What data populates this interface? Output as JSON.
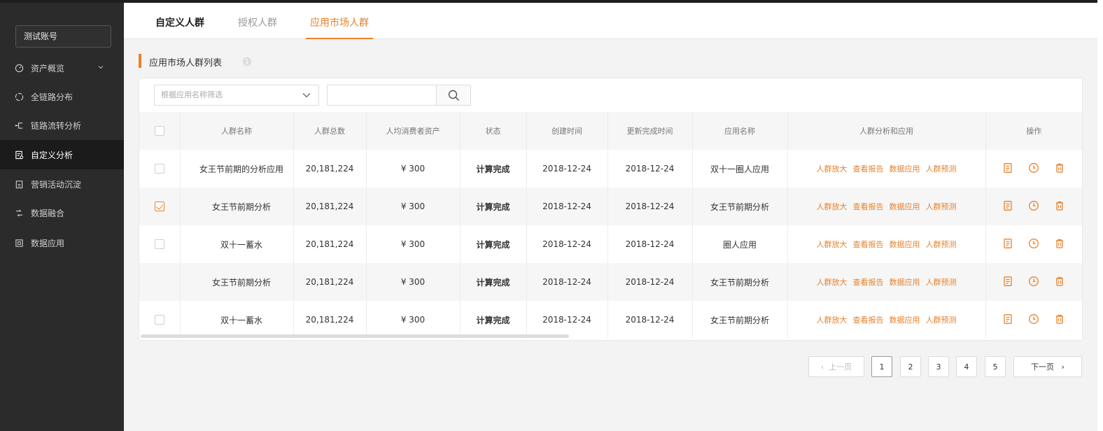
{
  "sidebar": {
    "account": "测试账号",
    "items": [
      {
        "label": "资产概览",
        "icon": "gauge-icon"
      },
      {
        "label": "全链路分布",
        "icon": "loop-icon"
      },
      {
        "label": "链路流转分析",
        "icon": "branch-icon"
      },
      {
        "label": "自定义分析",
        "icon": "custom-report-icon"
      },
      {
        "label": "营销活动沉淀",
        "icon": "clipboard-icon"
      },
      {
        "label": "数据融合",
        "icon": "fusion-icon"
      },
      {
        "label": "数据应用",
        "icon": "app-box-icon"
      }
    ],
    "active_index": 3
  },
  "tabs": [
    {
      "label": "自定义人群"
    },
    {
      "label": "授权人群"
    },
    {
      "label": "应用市场人群"
    }
  ],
  "active_tab": 2,
  "section": {
    "title": "应用市场人群列表"
  },
  "filter": {
    "placeholder": "根据应用名称筛选",
    "search_value": ""
  },
  "table": {
    "headers": [
      "人群名称",
      "人群总数",
      "人均消费者资产",
      "状态",
      "创建时间",
      "更新完成时间",
      "应用名称",
      "人群分析和应用",
      "操作"
    ],
    "action_links": [
      "人群放大",
      "查看报告",
      "数据应用",
      "人群预测"
    ],
    "rows": [
      {
        "name": "女王节前期的分析应用",
        "total": "20,181,224",
        "asset": "¥ 300",
        "status": "计算完成",
        "created": "2018-12-24",
        "updated": "2018-12-24",
        "app": "双十一圈人应用",
        "checkbox": "unchecked"
      },
      {
        "name": "女王节前期分析",
        "total": "20,181,224",
        "asset": "¥ 300",
        "status": "计算完成",
        "created": "2018-12-24",
        "updated": "2018-12-24",
        "app": "女王节前期分析",
        "checkbox": "checked"
      },
      {
        "name": "双十一蓄水",
        "total": "20,181,224",
        "asset": "¥ 300",
        "status": "计算完成",
        "created": "2018-12-24",
        "updated": "2018-12-24",
        "app": "圈人应用",
        "checkbox": "unchecked"
      },
      {
        "name": "女王节前期分析",
        "total": "20,181,224",
        "asset": "¥ 300",
        "status": "计算完成",
        "created": "2018-12-24",
        "updated": "2018-12-24",
        "app": "女王节前期分析",
        "checkbox": "none"
      },
      {
        "name": "双十一蓄水",
        "total": "20,181,224",
        "asset": "¥ 300",
        "status": "计算完成",
        "created": "2018-12-24",
        "updated": "2018-12-24",
        "app": "女王节前期分析",
        "checkbox": "unchecked"
      }
    ]
  },
  "pagination": {
    "prev_label": "上一页",
    "next_label": "下一页",
    "pages": [
      "1",
      "2",
      "3",
      "4",
      "5"
    ],
    "current": "1"
  },
  "colors": {
    "accent": "#e8812b",
    "sidebar_bg": "#2b2b2b",
    "sidebar_active_bg": "#1b1b1b"
  }
}
